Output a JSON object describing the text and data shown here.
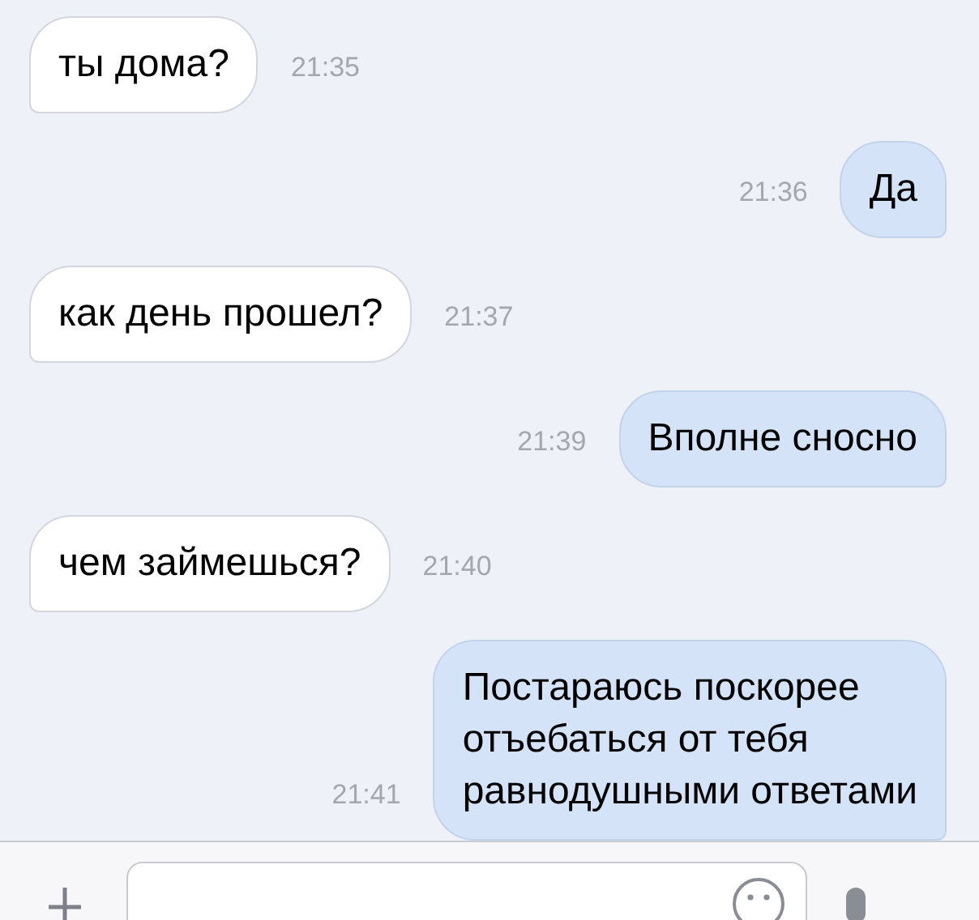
{
  "messages": [
    {
      "kind": "incoming",
      "text": "ты дома?",
      "time": "21:35"
    },
    {
      "kind": "outgoing",
      "text": "Да",
      "time": "21:36"
    },
    {
      "kind": "incoming",
      "text": "как день прошел?",
      "time": "21:37"
    },
    {
      "kind": "outgoing",
      "text": "Вполне сносно",
      "time": "21:39"
    },
    {
      "kind": "incoming",
      "text": "чем займешься?",
      "time": "21:40"
    },
    {
      "kind": "outgoing",
      "text": "Постараюсь поскорее\nотъебаться от тебя\nравнодушными ответами",
      "time": "21:41"
    }
  ]
}
